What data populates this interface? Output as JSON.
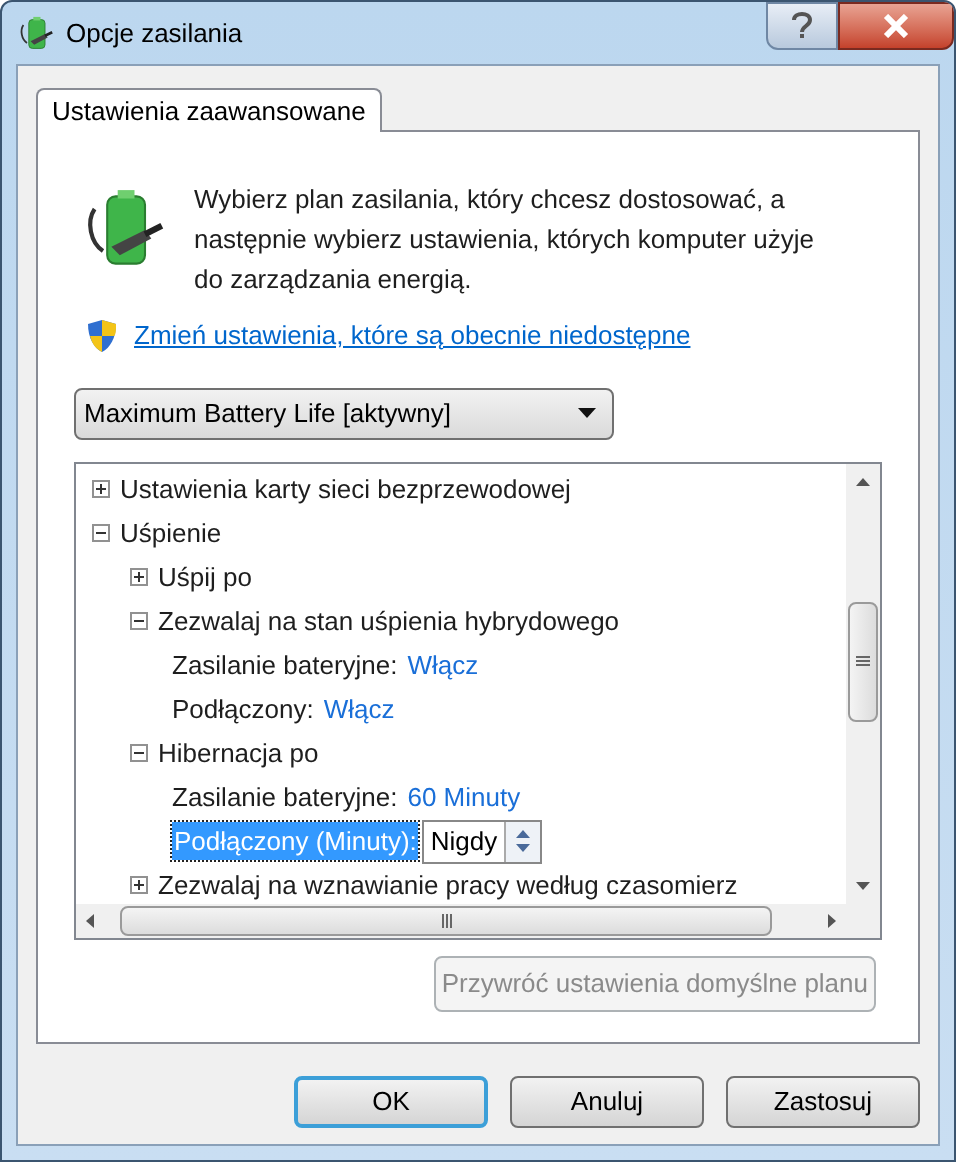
{
  "window": {
    "title": "Opcje zasilania"
  },
  "tabs": [
    {
      "label": "Ustawienia zaawansowane",
      "selected": true
    }
  ],
  "intro": {
    "text": "Wybierz plan zasilania, który chcesz dostosować, a następnie wybierz ustawienia, których komputer użyje do zarządzania energią.",
    "link": "Zmień ustawienia, które są obecnie niedostępne"
  },
  "plan_dropdown": {
    "value": "Maximum Battery Life [aktywny]"
  },
  "tree": [
    {
      "kind": "group",
      "label": "Ustawienia karty sieci bezprzewodowej",
      "expanded": false
    },
    {
      "kind": "group",
      "label": "Uśpienie",
      "expanded": true,
      "children": [
        {
          "kind": "group",
          "label": "Uśpij po",
          "expanded": false
        },
        {
          "kind": "group",
          "label": "Zezwalaj na stan uśpienia hybrydowego",
          "expanded": true,
          "children": [
            {
              "kind": "setting",
              "label": "Zasilanie bateryjne:",
              "value": "Włącz",
              "selected": false
            },
            {
              "kind": "setting",
              "label": "Podłączony:",
              "value": "Włącz",
              "selected": false
            }
          ]
        },
        {
          "kind": "group",
          "label": "Hibernacja po",
          "expanded": true,
          "children": [
            {
              "kind": "setting",
              "label": "Zasilanie bateryjne:",
              "value": "60 Minuty",
              "selected": false
            },
            {
              "kind": "spin",
              "label": "Podłączony (Minuty):",
              "value": "Nigdy",
              "selected": true
            }
          ]
        },
        {
          "kind": "group",
          "label": "Zezwalaj na wznawianie pracy według czasomierz",
          "expanded": false
        }
      ]
    }
  ],
  "restore_button": {
    "label": "Przywróć ustawienia domyślne planu",
    "disabled": true
  },
  "buttons": [
    {
      "label": "OK",
      "default": true
    },
    {
      "label": "Anuluj",
      "default": false
    },
    {
      "label": "Zastosuj",
      "default": false
    }
  ]
}
